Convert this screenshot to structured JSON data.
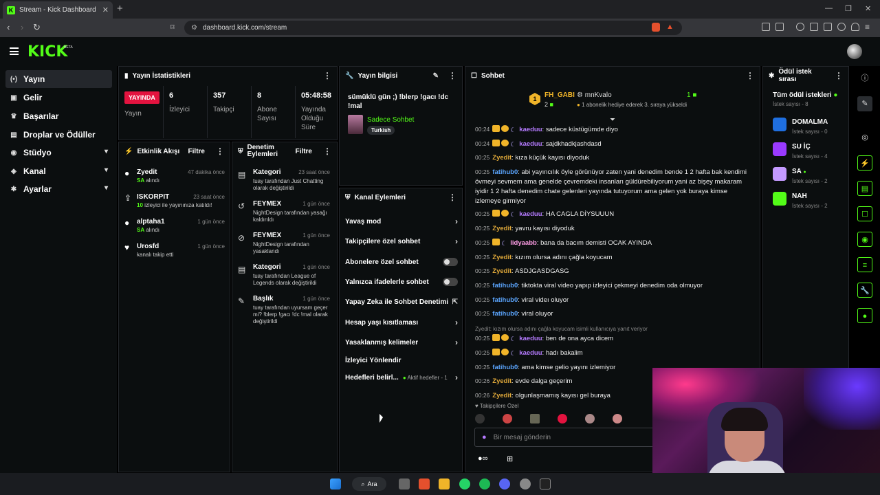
{
  "browser": {
    "tab_title": "Stream - Kick Dashboard",
    "url": "dashboard.kick.com/stream"
  },
  "brand": {
    "logo": "KICK",
    "beta": "BETA",
    "accent": "#53fc18"
  },
  "nav": {
    "items": [
      {
        "label": "Yayın",
        "icon": "broadcast-icon"
      },
      {
        "label": "Gelir",
        "icon": "money-icon"
      },
      {
        "label": "Başarılar",
        "icon": "trophy-icon"
      },
      {
        "label": "Droplar ve Ödüller",
        "icon": "gift-icon"
      },
      {
        "label": "Stüdyo",
        "icon": "studio-icon"
      },
      {
        "label": "Kanal",
        "icon": "channel-icon"
      },
      {
        "label": "Ayarlar",
        "icon": "gear-icon"
      }
    ]
  },
  "stats": {
    "title": "Yayın İstatistikleri",
    "live_badge": "YAYINDA",
    "live_label": "Yayın",
    "viewers": {
      "value": "6",
      "label": "İzleyici"
    },
    "followers": {
      "value": "357",
      "label": "Takipçi"
    },
    "subs": {
      "value": "8",
      "label": "Abone Sayısı"
    },
    "uptime": {
      "value": "05:48:58",
      "label": "Yayında Olduğu Süre"
    }
  },
  "stream_info": {
    "title": "Yayın bilgisi",
    "stream_title": "sümüklü gün ;) !blerp !gacı !dc !mal",
    "category": "Sadece Sohbet",
    "language": "Turkish"
  },
  "activity": {
    "title": "Etkinlik Akışı",
    "filter": "Filtre",
    "items": [
      {
        "name": "Zyedit",
        "time": "47 dakika önce",
        "hl": "SA",
        "desc": " alındı"
      },
      {
        "name": "ISKORPIT",
        "time": "23 saat önce",
        "hl": "10",
        "desc": " izleyici ile yayınınıza katıldı!"
      },
      {
        "name": "alptaha1",
        "time": "1 gün önce",
        "hl": "SA",
        "desc": " alındı"
      },
      {
        "name": "Urosfd",
        "time": "1 gün önce",
        "hl": "",
        "desc": "kanalı takip etti"
      }
    ]
  },
  "moderation": {
    "title": "Denetim Eylemleri",
    "filter": "Filtre",
    "items": [
      {
        "name": "Kategori",
        "time": "23 saat önce",
        "desc": "tuay tarafından Just Chatting olarak değiştirildi"
      },
      {
        "name": "FEYMEX",
        "time": "1 gün önce",
        "desc": "NightDesign tarafından yasağı kaldırıldı"
      },
      {
        "name": "FEYMEX",
        "time": "1 gün önce",
        "desc": "NightDesign tarafından yasaklandı"
      },
      {
        "name": "Kategori",
        "time": "1 gün önce",
        "desc": "tuay tarafından League of Legends olarak değiştirildi"
      },
      {
        "name": "Başlık",
        "time": "1 gün önce",
        "desc": "tuay tarafından uyursam geçer mi? !blerp !gacı !dc !mal olarak değiştirildi"
      }
    ]
  },
  "channel_actions": {
    "title": "Kanal Eylemleri",
    "items": [
      {
        "label": "Yavaş mod",
        "kind": "arrow"
      },
      {
        "label": "Takipçilere özel sohbet",
        "kind": "arrow"
      },
      {
        "label": "Abonelere özel sohbet",
        "kind": "toggle"
      },
      {
        "label": "Yalnızca ifadelerle sohbet",
        "kind": "toggle"
      },
      {
        "label": "Yapay Zeka ile Sohbet Denetimi",
        "kind": "external"
      },
      {
        "label": "Hesap yaşı kısıtlaması",
        "kind": "arrow"
      },
      {
        "label": "Yasaklanmış kelimeler",
        "kind": "arrow"
      },
      {
        "label": "İzleyici Yönlendir",
        "kind": "none"
      },
      {
        "label": "Hedefleri belirl...",
        "kind": "arrow",
        "extra": "Aktif hedefler - 1"
      }
    ]
  },
  "chat": {
    "title": "Sohbet",
    "leader1": {
      "name": "FH_GABI",
      "rank": "1",
      "count": "2"
    },
    "leader2": {
      "name": "mnKvalo",
      "count": "1",
      "desc": "1 abonelik hediye ederek 3. sıraya yükseldi"
    },
    "messages": [
      {
        "time": "00:24",
        "user": "kaeduu",
        "color": "p",
        "badges": [
          "cr",
          "co",
          "mo"
        ],
        "text": "sadece küstügümde diyo"
      },
      {
        "time": "00:24",
        "user": "kaeduu",
        "color": "p",
        "badges": [
          "cr",
          "co",
          "mo"
        ],
        "text": "sajdkhadkjashdasd"
      },
      {
        "time": "00:25",
        "user": "Zyedit",
        "color": "o",
        "badges": [],
        "text": "kıza küçük kayısı diyoduk"
      },
      {
        "time": "00:25",
        "user": "fatihub0",
        "color": "b",
        "badges": [],
        "text": "abi yayıncılık öyle görünüyor zaten yani denedim bende 1 2 hafta bak kendimi övmeyi sevmem ama genelde çevremdeki insanları güldürebiliyorum yani az bişey makaram iyidir 1 2 hafta denedim chate gelenleri yayında tutuyorum ama gelen yok buraya kimse izlemeye girmiyor"
      },
      {
        "time": "00:25",
        "user": "kaeduu",
        "color": "p",
        "badges": [
          "cr",
          "co",
          "mo"
        ],
        "text": "HA CAGLA DİYSUUUN"
      },
      {
        "time": "00:25",
        "user": "Zyedit",
        "color": "o",
        "badges": [],
        "text": "yavru kayısı diyoduk"
      },
      {
        "time": "00:25",
        "user": "lidyaabb",
        "color": "pk",
        "badges": [
          "cr",
          "mo"
        ],
        "text": "bana da bacım demisti OCAK AYINDA"
      },
      {
        "time": "00:25",
        "user": "Zyedit",
        "color": "o",
        "badges": [],
        "text": "kızım olursa adını çağla koyucam"
      },
      {
        "time": "00:25",
        "user": "Zyedit",
        "color": "o",
        "badges": [],
        "text": "ASDJGASDGASG"
      },
      {
        "time": "00:25",
        "user": "fatihub0",
        "color": "b",
        "badges": [],
        "text": "tiktokta viral video yapıp izleyici çekmeyi denedim oda olmuyor"
      },
      {
        "time": "00:25",
        "user": "fatihub0",
        "color": "b",
        "badges": [],
        "text": "viral videı oluyor"
      },
      {
        "time": "00:25",
        "user": "fatihub0",
        "color": "b",
        "badges": [],
        "text": "viral oluyor"
      },
      {
        "time": "00:25",
        "user": "kaeduu",
        "color": "p",
        "badges": [
          "cr",
          "co",
          "mo"
        ],
        "text": "ben de ona ayca dicem",
        "reply": "Zyedit: kızım olursa adını çağla koyucam isimli kullanıcıya yanıt veriyor"
      },
      {
        "time": "00:25",
        "user": "kaeduu",
        "color": "p",
        "badges": [
          "cr",
          "co",
          "mo"
        ],
        "text": "hadı bakalim"
      },
      {
        "time": "00:25",
        "user": "fatihub0",
        "color": "b",
        "badges": [],
        "text": "ama kimse gelio yayını izlemiyor"
      },
      {
        "time": "00:26",
        "user": "Zyedit",
        "color": "o",
        "badges": [],
        "text": "evde dalga geçerim"
      },
      {
        "time": "00:26",
        "user": "Zyedit",
        "color": "o",
        "badges": [],
        "text": "olgunlaşmamış kayısı gel buraya"
      }
    ],
    "followers_only": "Takipçilere Özel",
    "placeholder": "Bir mesaj gönderin"
  },
  "rewards": {
    "title": "Ödül istek sırası",
    "all_label": "Tüm ödül istekleri",
    "all_count": "İstek sayısı - 8",
    "items": [
      {
        "name": "DOMALMA",
        "count": "İstek sayısı - 0",
        "color": "#1f6fe0"
      },
      {
        "name": "SU İÇ",
        "count": "İstek sayısı - 4",
        "color": "#9a3aff"
      },
      {
        "name": "SA",
        "count": "İstek sayısı - 2",
        "color": "#c49aff"
      },
      {
        "name": "NAH",
        "count": "İstek sayısı - 2",
        "color": "#53fc18"
      }
    ]
  },
  "taskbar": {
    "search_label": "Ara"
  }
}
